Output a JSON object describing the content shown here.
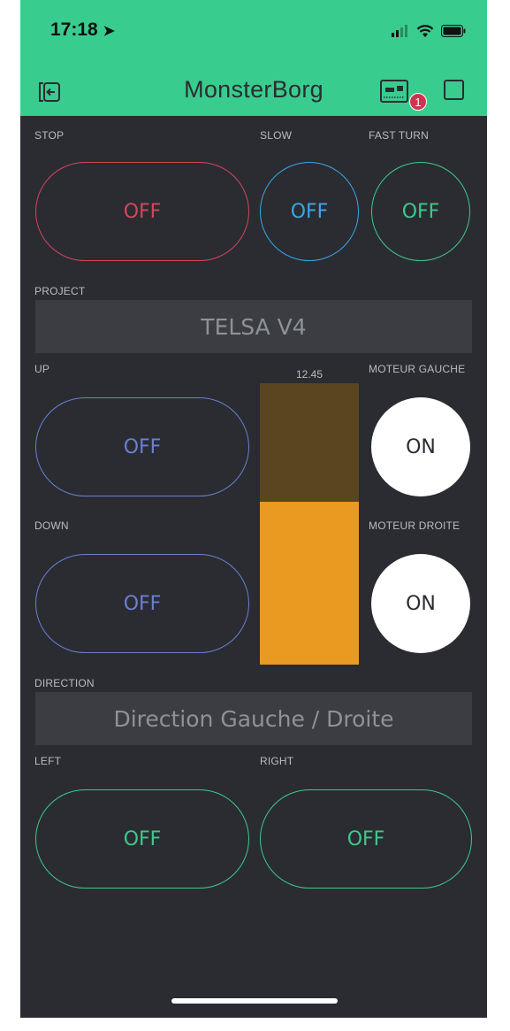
{
  "status_bar": {
    "time": "17:18",
    "location_icon": "location-arrow-icon",
    "signal_icon": "signal-icon",
    "wifi_icon": "wifi-icon",
    "battery_icon": "battery-icon"
  },
  "header": {
    "title": "MonsterBorg",
    "badge_count": "1"
  },
  "widgets": {
    "stop": {
      "label": "STOP",
      "value": "OFF",
      "color": "#d6455b"
    },
    "slow": {
      "label": "SLOW",
      "value": "OFF",
      "color": "#3aa7e6"
    },
    "fast_turn": {
      "label": "FAST TURN",
      "value": "OFF",
      "color": "#3dc98c"
    },
    "project": {
      "label": "PROJECT",
      "value": "TELSA V4"
    },
    "up": {
      "label": "UP",
      "value": "OFF",
      "color": "#6b7fd4"
    },
    "slider": {
      "value": "12.45",
      "fill_fraction": 0.58,
      "color": "#e99a21"
    },
    "moteur_gauche": {
      "label": "MOTEUR GAUCHE",
      "value": "ON"
    },
    "down": {
      "label": "DOWN",
      "value": "OFF",
      "color": "#6b7fd4"
    },
    "moteur_droite": {
      "label": "MOTEUR DROITE",
      "value": "ON"
    },
    "direction": {
      "label": "DIRECTION",
      "value": "Direction Gauche / Droite"
    },
    "left": {
      "label": "LEFT",
      "value": "OFF",
      "color": "#3dc98c"
    },
    "right": {
      "label": "RIGHT",
      "value": "OFF",
      "color": "#3dc98c"
    }
  },
  "colors": {
    "header": "#39cc8f",
    "background": "#2a2c31"
  }
}
